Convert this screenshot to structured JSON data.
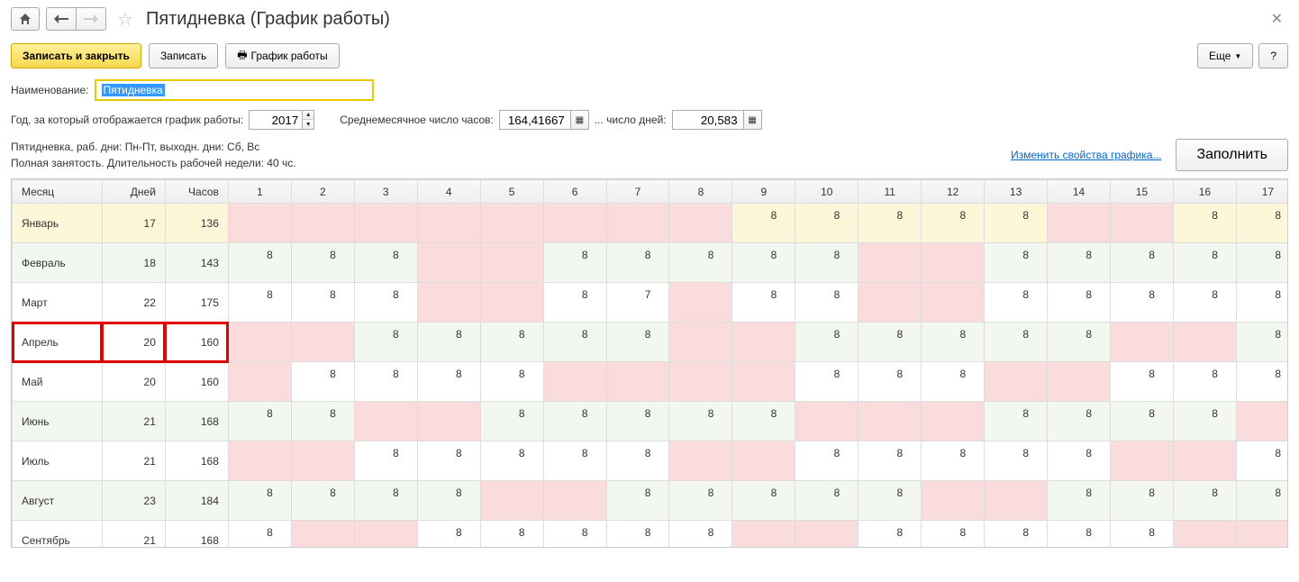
{
  "header": {
    "title": "Пятидневка (График работы)"
  },
  "toolbar": {
    "save_close": "Записать и закрыть",
    "save": "Записать",
    "schedule": "График работы",
    "more": "Еще",
    "help": "?"
  },
  "form": {
    "name_label": "Наименование:",
    "name_value": "Пятидневка",
    "year_label": "Год, за который отображается график работы:",
    "year_value": "2017",
    "avg_hours_label": "Среднемесячное число часов:",
    "avg_hours_value": "164,41667",
    "avg_days_label": "... число дней:",
    "avg_days_value": "20,583"
  },
  "info": {
    "line1": "Пятидневка, раб. дни: Пн-Пт, выходн. дни: Сб, Вс",
    "line2": "Полная занятость. Длительность рабочей недели: 40 чс.",
    "edit_link": "Изменить свойства графика...",
    "fill_btn": "Заполнить"
  },
  "table": {
    "cols": {
      "month": "Месяц",
      "days": "Дней",
      "hours": "Часов"
    },
    "day_cols": [
      "1",
      "2",
      "3",
      "4",
      "5",
      "6",
      "7",
      "8",
      "9",
      "10",
      "11",
      "12",
      "13",
      "14",
      "15",
      "16",
      "17"
    ],
    "rows": [
      {
        "month": "Январь",
        "days": "17",
        "hours": "136",
        "yellow": true,
        "cells": [
          "w",
          "w",
          "w",
          "w",
          "w",
          "w",
          "w",
          "w",
          "8",
          "8",
          "8",
          "8",
          "8",
          "w",
          "w",
          "8",
          "8"
        ]
      },
      {
        "month": "Февраль",
        "days": "18",
        "hours": "143",
        "green": true,
        "cells": [
          "8",
          "8",
          "8",
          "w",
          "w",
          "8",
          "8",
          "8",
          "8",
          "8",
          "w",
          "w",
          "8",
          "8",
          "8",
          "8",
          "8"
        ]
      },
      {
        "month": "Март",
        "days": "22",
        "hours": "175",
        "cells": [
          "8",
          "8",
          "8",
          "w",
          "w",
          "8",
          "7",
          "w",
          "8",
          "8",
          "w",
          "w",
          "8",
          "8",
          "8",
          "8",
          "8"
        ]
      },
      {
        "month": "Апрель",
        "days": "20",
        "hours": "160",
        "green": true,
        "highlight": true,
        "cells": [
          "w",
          "w",
          "8",
          "8",
          "8",
          "8",
          "8",
          "w",
          "w",
          "8",
          "8",
          "8",
          "8",
          "8",
          "w",
          "w",
          "8"
        ]
      },
      {
        "month": "Май",
        "days": "20",
        "hours": "160",
        "cells": [
          "w",
          "8",
          "8",
          "8",
          "8",
          "w",
          "w",
          "w",
          "w",
          "8",
          "8",
          "8",
          "w",
          "w",
          "8",
          "8",
          "8"
        ]
      },
      {
        "month": "Июнь",
        "days": "21",
        "hours": "168",
        "green": true,
        "cells": [
          "8",
          "8",
          "w",
          "w",
          "8",
          "8",
          "8",
          "8",
          "8",
          "w",
          "w",
          "w",
          "8",
          "8",
          "8",
          "8",
          "w"
        ]
      },
      {
        "month": "Июль",
        "days": "21",
        "hours": "168",
        "cells": [
          "w",
          "w",
          "8",
          "8",
          "8",
          "8",
          "8",
          "w",
          "w",
          "8",
          "8",
          "8",
          "8",
          "8",
          "w",
          "w",
          "8"
        ]
      },
      {
        "month": "Август",
        "days": "23",
        "hours": "184",
        "green": true,
        "cells": [
          "8",
          "8",
          "8",
          "8",
          "w",
          "w",
          "8",
          "8",
          "8",
          "8",
          "8",
          "w",
          "w",
          "8",
          "8",
          "8",
          "8"
        ]
      },
      {
        "month": "Сентябрь",
        "days": "21",
        "hours": "168",
        "cells": [
          "8",
          "w",
          "w",
          "8",
          "8",
          "8",
          "8",
          "8",
          "w",
          "w",
          "8",
          "8",
          "8",
          "8",
          "8",
          "w",
          "w"
        ]
      }
    ]
  }
}
